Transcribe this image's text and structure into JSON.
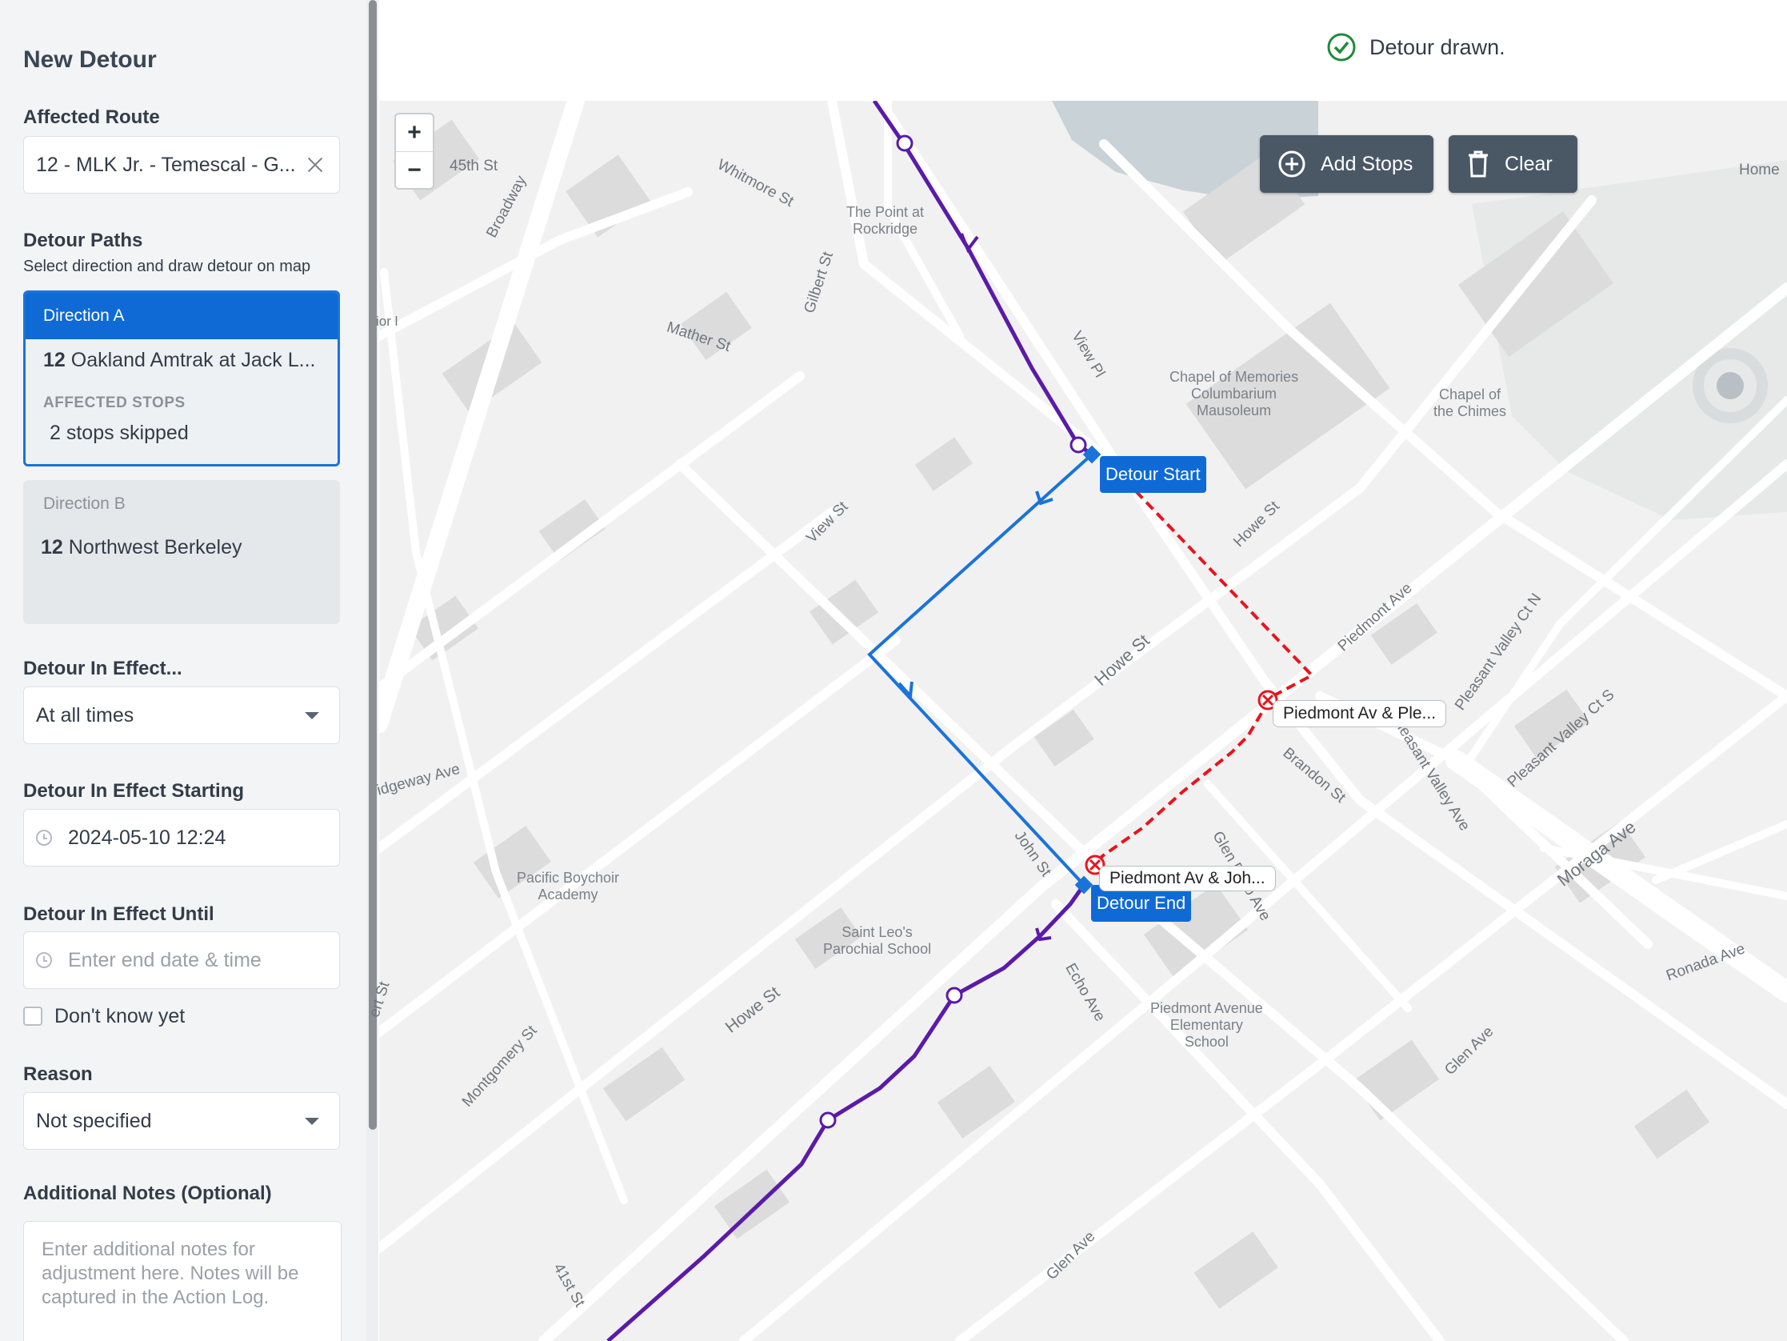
{
  "sidebar": {
    "title": "New Detour",
    "affected_route": {
      "label": "Affected Route",
      "value": "12 - MLK Jr. - Temescal - G..."
    },
    "detour_paths": {
      "label": "Detour Paths",
      "hint": "Select direction and draw detour on map",
      "direction_a": {
        "head": "Direction A",
        "route_num": "12",
        "route_name": "Oakland Amtrak at Jack L...",
        "affected_label": "AFFECTED STOPS",
        "affected_value": "2 stops skipped"
      },
      "direction_b": {
        "head": "Direction B",
        "route_num": "12",
        "route_name": "Northwest Berkeley"
      }
    },
    "in_effect": {
      "label": "Detour In Effect...",
      "value": "At all times"
    },
    "starting": {
      "label": "Detour In Effect Starting",
      "value": "2024-05-10 12:24"
    },
    "until": {
      "label": "Detour In Effect Until",
      "placeholder": "Enter end date & time",
      "dont_know": "Don't know yet"
    },
    "reason": {
      "label": "Reason",
      "value": "Not specified"
    },
    "notes": {
      "label": "Additional Notes (Optional)",
      "placeholder": "Enter additional notes for adjustment here. Notes will be captured in the Action Log."
    }
  },
  "map": {
    "toast": "Detour drawn.",
    "zoom_in": "+",
    "zoom_out": "−",
    "add_stops": "Add Stops",
    "clear": "Clear",
    "detour_start": "Detour Start",
    "detour_end": "Detour End",
    "stop_1": "Piedmont Av & Ple...",
    "stop_2": "Piedmont Av & Joh...",
    "streets": [
      "45th St",
      "Broadway",
      "Whitmore St",
      "Gilbert St",
      "Mather St",
      "View Pl",
      "View St",
      "Howe St",
      "Howe St",
      "Howe St",
      "Piedmont Ave",
      "Pleasant Valley Ct N",
      "Pleasant Valley Ct S",
      "Brandon St",
      "Pleasant Valley Ave",
      "Moraga Ave",
      "Ronada Ave",
      "Glen Ave",
      "Glen Ave",
      "Echo Ave",
      "John St",
      "Glen Echo Ave",
      "Montgomery St",
      "41st St",
      "Home",
      "idgeway Ave",
      "ert St",
      "ior l"
    ],
    "places": [
      "The Point at\nRockridge",
      "Chapel of Memories\nColumbarium\nMausoleum",
      "Chapel of\nthe Chimes",
      "Pacific Boychoir\nAcademy",
      "Saint Leo's\nParochial School",
      "Piedmont Avenue\nElementary\nSchool"
    ],
    "colors": {
      "route": "#5b1aa8",
      "detour": "#1a73d9",
      "skipped": "#e8141e",
      "primary": "#0f6ad6"
    }
  }
}
